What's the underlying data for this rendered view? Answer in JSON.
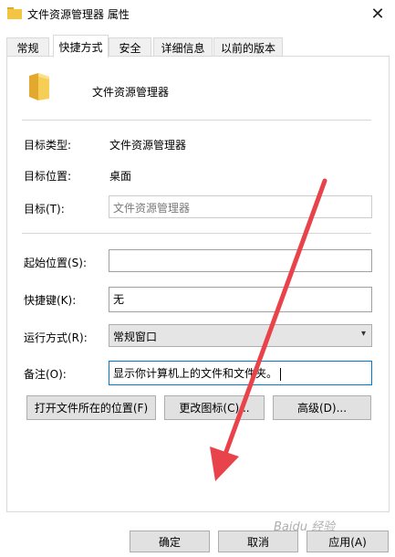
{
  "window": {
    "title": "文件资源管理器 属性",
    "close_symbol": "✕"
  },
  "tabs": [
    {
      "label": "常规",
      "active": false
    },
    {
      "label": "快捷方式",
      "active": true
    },
    {
      "label": "安全",
      "active": false
    },
    {
      "label": "详细信息",
      "active": false
    },
    {
      "label": "以前的版本",
      "active": false
    }
  ],
  "header": {
    "icon": "folder-icon",
    "app_name": "文件资源管理器"
  },
  "info": {
    "target_type_label": "目标类型:",
    "target_type_value": "文件资源管理器",
    "target_location_label": "目标位置:",
    "target_location_value": "桌面",
    "target_label": "目标(T):",
    "target_value": "文件资源管理器"
  },
  "fields": {
    "start_in_label": "起始位置(S):",
    "start_in_value": "",
    "shortcut_key_label": "快捷键(K):",
    "shortcut_key_value": "无",
    "run_label": "运行方式(R):",
    "run_value": "常规窗口",
    "comment_label": "备注(O):",
    "comment_value": "显示你计算机上的文件和文件夹。"
  },
  "buttons": {
    "open_location": "打开文件所在的位置(F)",
    "change_icon": "更改图标(C)...",
    "advanced": "高级(D)..."
  },
  "footer": {
    "ok": "确定",
    "cancel": "取消",
    "apply": "应用(A)"
  },
  "watermark": "Baidu 经验",
  "colors": {
    "folder": "#f4c542",
    "annotation_arrow": "#e8434a",
    "focus_border": "#0078d7"
  }
}
